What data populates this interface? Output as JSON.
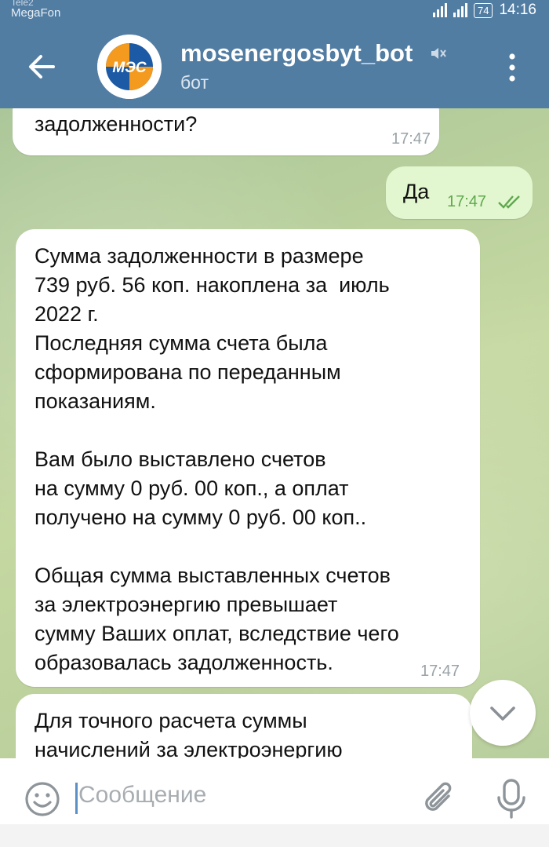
{
  "status_bar": {
    "carrier_top": "Tele2",
    "carrier": "MegaFon",
    "battery": "74",
    "time": "14:16"
  },
  "header": {
    "title": "mosenergosbyt_bot",
    "subtitle": "бот",
    "avatar_text": "МЭС",
    "accent": "#527da3"
  },
  "messages": [
    {
      "direction": "in",
      "text": "задолженности?",
      "time": "17:47"
    },
    {
      "direction": "out",
      "text": "Да",
      "time": "17:47",
      "status": "read"
    },
    {
      "direction": "in",
      "text": "Сумма задолженности в размере\n739 руб. 56 коп. накоплена за  июль\n2022 г.\nПоследняя сумма счета была\nсформирована по переданным\nпоказаниям.\n\nВам было выставлено счетов\nна сумму 0 руб. 00 коп., а оплат\nполучено на сумму 0 руб. 00 коп..\n\nОбщая сумма выставленных счетов\nза электроэнергию превышает\nсумму Ваших оплат, вследствие чего\nобразовалась задолженность.",
      "time": "17:47"
    },
    {
      "direction": "in",
      "text": "Для точного расчета суммы\nначислений за электроэнергию",
      "time": ""
    }
  ],
  "input": {
    "placeholder": "Сообщение"
  },
  "icons": {
    "back": "arrow-left-icon",
    "mute": "muted-icon",
    "menu": "more-vert-icon",
    "emoji": "emoji-icon",
    "attach": "paperclip-icon",
    "mic": "microphone-icon",
    "scroll": "chevron-down-icon"
  }
}
